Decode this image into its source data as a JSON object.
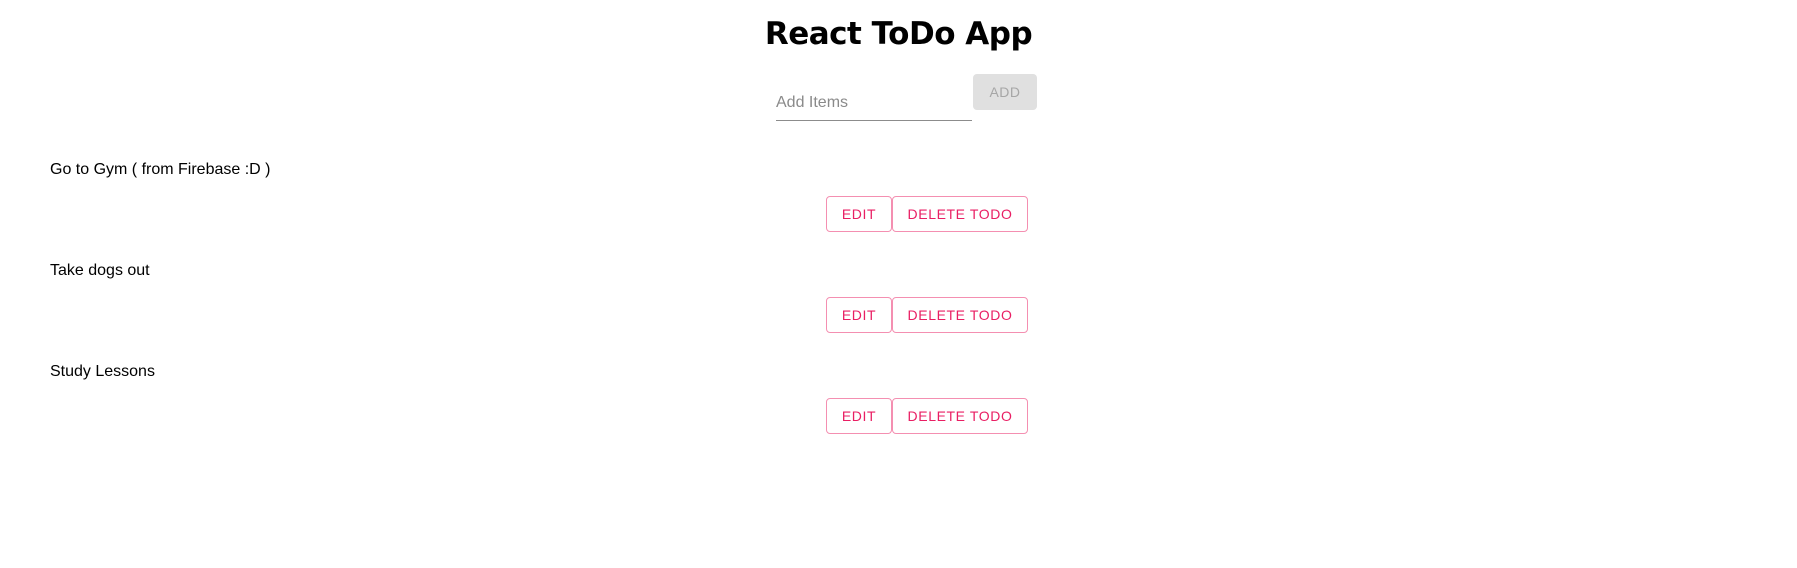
{
  "header": {
    "title": "React ToDo App"
  },
  "form": {
    "input_placeholder": "Add Items",
    "input_value": "",
    "add_label": "ADD"
  },
  "todos": [
    {
      "text": "Go to Gym ( from Firebase :D )",
      "edit_label": "EDIT",
      "delete_label": "DELETE TODO"
    },
    {
      "text": "Take dogs out",
      "edit_label": "EDIT",
      "delete_label": "DELETE TODO"
    },
    {
      "text": "Study Lessons",
      "edit_label": "EDIT",
      "delete_label": "DELETE TODO"
    }
  ],
  "colors": {
    "accent": "#e91e63",
    "accent_border": "#f48fb1",
    "disabled_bg": "#e0e0e0",
    "disabled_text": "#a6a6a6"
  }
}
